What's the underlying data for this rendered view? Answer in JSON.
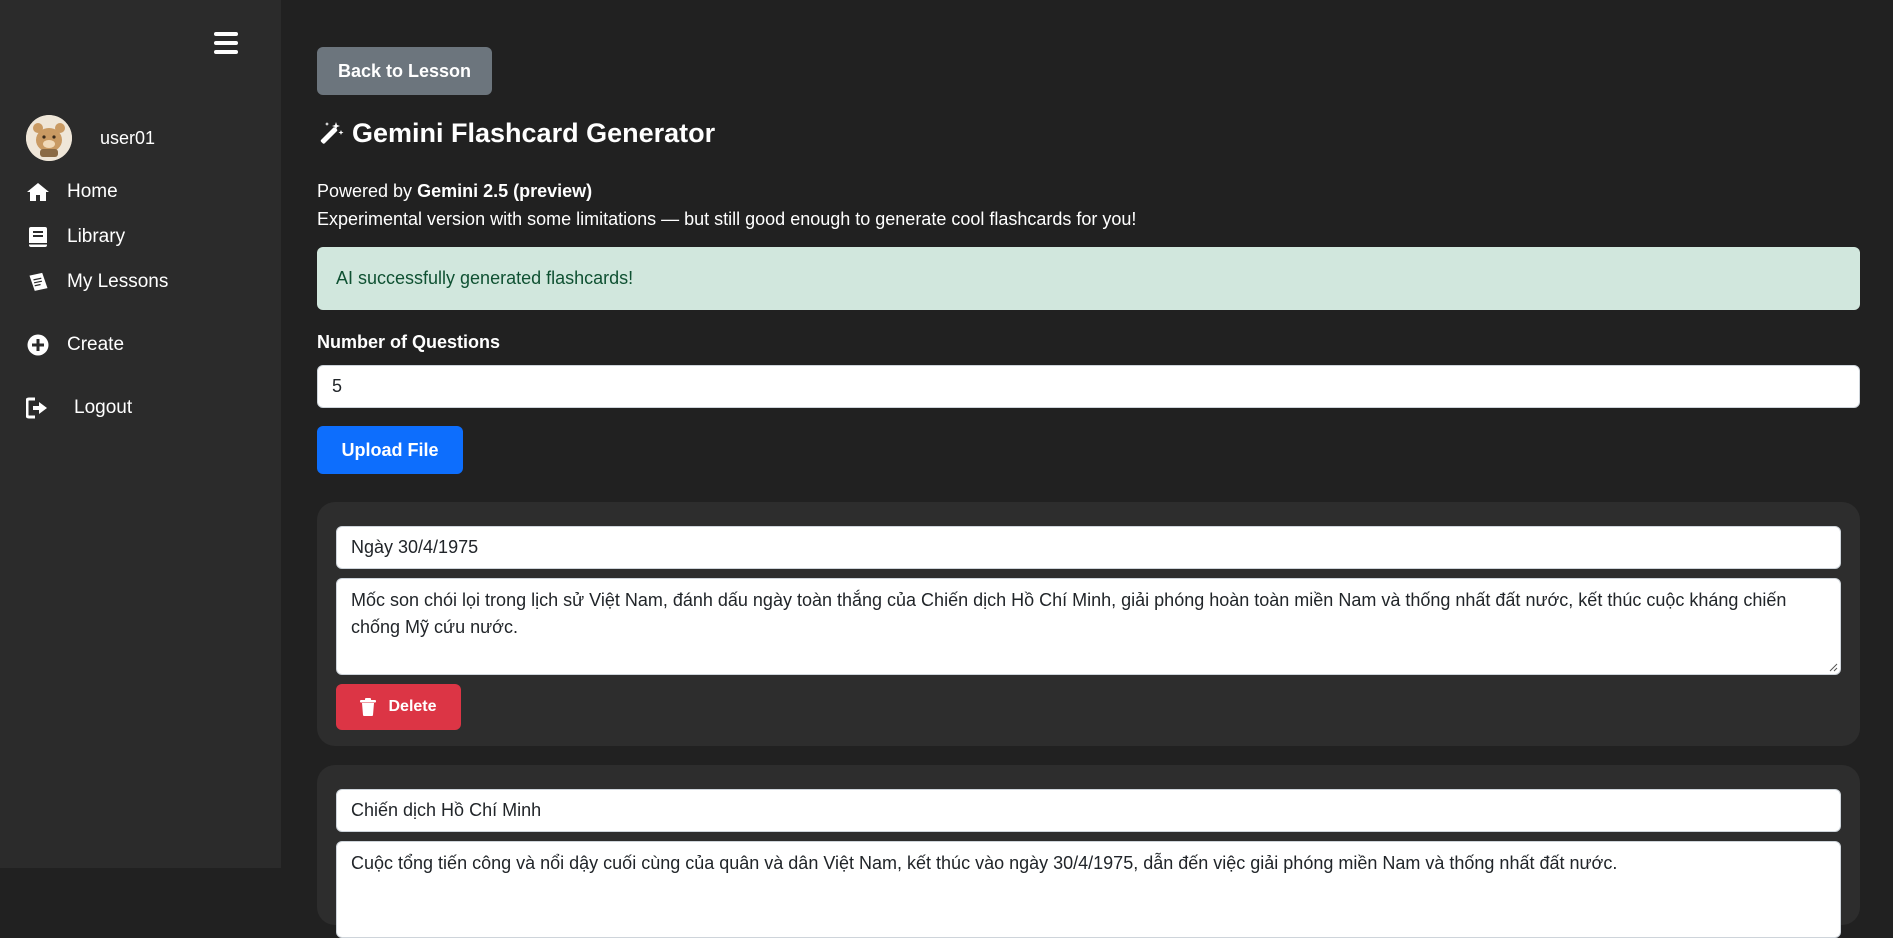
{
  "sidebar": {
    "username": "user01",
    "nav": [
      {
        "label": "Home",
        "icon": "home-icon"
      },
      {
        "label": "Library",
        "icon": "book-icon"
      },
      {
        "label": "My Lessons",
        "icon": "notebook-icon"
      },
      {
        "label": "Create",
        "icon": "plus-circle-icon"
      },
      {
        "label": "Logout",
        "icon": "logout-icon"
      }
    ]
  },
  "main": {
    "back_label": "Back to Lesson",
    "title": "Gemini Flashcard Generator",
    "powered_prefix": "Powered by",
    "powered_model": "Gemini 2.5 (preview)",
    "description": "Experimental version with some limitations — but still good enough to generate cool flashcards for you!",
    "alert": "AI successfully generated flashcards!",
    "num_questions_label": "Number of Questions",
    "num_questions_value": "5",
    "upload_label": "Upload File",
    "delete_label": "Delete",
    "cards": [
      {
        "term": "Ngày 30/4/1975",
        "definition": "Mốc son chói lọi trong lịch sử Việt Nam, đánh dấu ngày toàn thắng của Chiến dịch Hồ Chí Minh, giải phóng hoàn toàn miền Nam và thống nhất đất nước, kết thúc cuộc kháng chiến chống Mỹ cứu nước."
      },
      {
        "term": "Chiến dịch Hồ Chí Minh",
        "definition": "Cuộc tổng tiến công và nổi dậy cuối cùng của quân và dân Việt Nam, kết thúc vào ngày 30/4/1975, dẫn đến việc giải phóng miền Nam và thống nhất đất nước."
      }
    ]
  },
  "colors": {
    "background": "#212121",
    "sidebar": "#2b2b2b",
    "primary": "#0d6efd",
    "secondary": "#6c757d",
    "danger": "#dc3545",
    "success_bg": "#d1e7dd",
    "success_text": "#0f5132"
  }
}
